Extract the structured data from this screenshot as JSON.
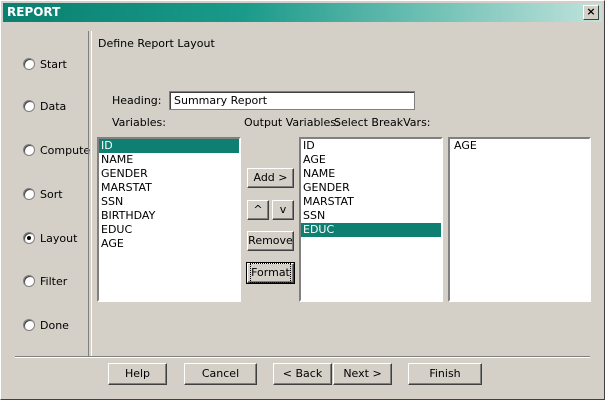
{
  "window": {
    "title": "REPORT",
    "close_symbol": "×"
  },
  "steps": [
    {
      "label": "Start",
      "checked": false
    },
    {
      "label": "Data",
      "checked": false
    },
    {
      "label": "Compute",
      "checked": false
    },
    {
      "label": "Sort",
      "checked": false
    },
    {
      "label": "Layout",
      "checked": true
    },
    {
      "label": "Filter",
      "checked": false
    },
    {
      "label": "Done",
      "checked": false
    }
  ],
  "main": {
    "section_title": "Define Report Layout",
    "heading_label": "Heading:",
    "heading_value": "Summary Report",
    "variables_label": "Variables:",
    "output_label": "Output Variables:",
    "breakvars_label": "Select BreakVars:",
    "variables": [
      "ID",
      "NAME",
      "GENDER",
      "MARSTAT",
      "SSN",
      "BIRTHDAY",
      "EDUC",
      "AGE"
    ],
    "variables_selected": "ID",
    "output_variables": [
      "ID",
      "AGE",
      "NAME",
      "GENDER",
      "MARSTAT",
      "SSN",
      "EDUC"
    ],
    "output_selected": "EDUC",
    "breakvars": [
      "AGE"
    ],
    "buttons": {
      "add": "Add >",
      "up": "^",
      "down": "v",
      "remove": "Remove",
      "format": "Format"
    }
  },
  "footer": {
    "help": "Help",
    "cancel": "Cancel",
    "back": "< Back",
    "next": "Next >",
    "finish": "Finish"
  },
  "colors": {
    "selection": "#0f7f72",
    "title_start": "#0a8070",
    "title_end": "#bfe3dc",
    "face": "#d4d0c8"
  }
}
